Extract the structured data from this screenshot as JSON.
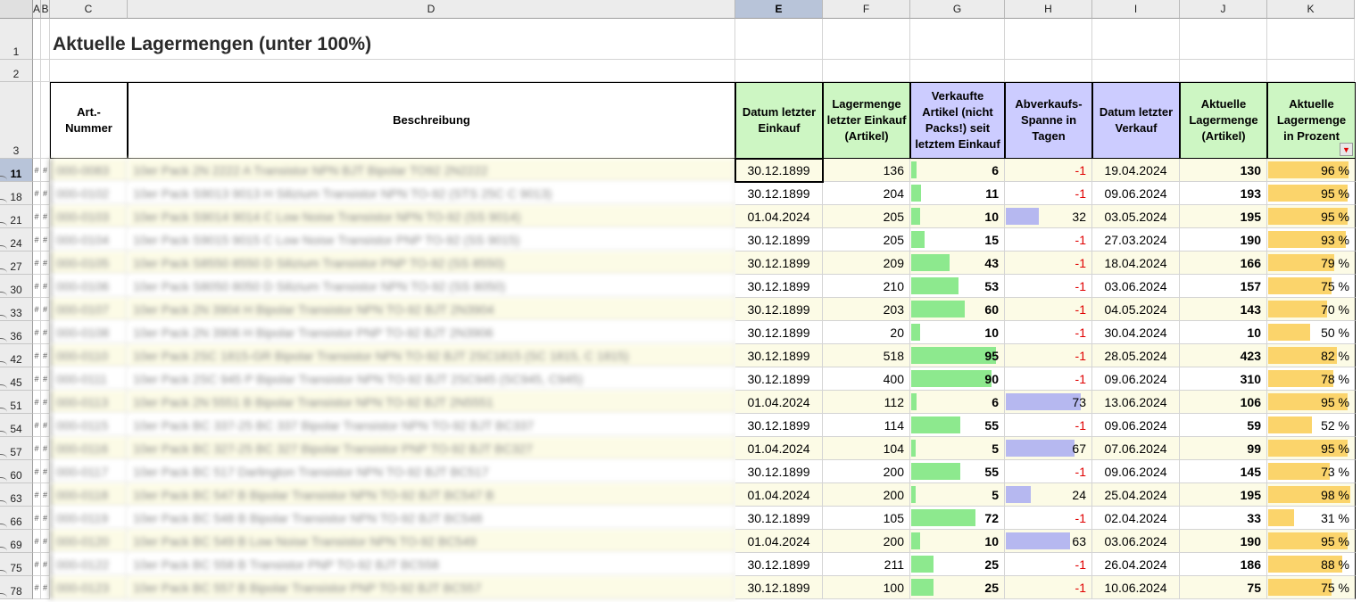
{
  "column_headers": [
    "A",
    "B",
    "C",
    "D",
    "E",
    "F",
    "G",
    "H",
    "I",
    "J",
    "K"
  ],
  "selected_column": "E",
  "row_numbers": [
    "1",
    "2",
    "3",
    "11",
    "18",
    "21",
    "24",
    "27",
    "30",
    "33",
    "36",
    "42",
    "45",
    "51",
    "54",
    "57",
    "60",
    "63",
    "66",
    "69",
    "75",
    "78"
  ],
  "selected_row": "11",
  "hash_marker": "#",
  "title": "Aktuelle Lagermengen (unter 100%)",
  "table_headers": {
    "art_nr": "Art.-Nummer",
    "beschreibung": "Beschreibung",
    "datum_einkauf": "Datum letzter Einkauf",
    "lagermenge_einkauf": "Lagermenge letzter Einkauf (Artikel)",
    "verkaufte": "Verkaufte Artikel (nicht Packs!) seit letztem Einkauf",
    "spanne": "Abverkaufs-Spanne in Tagen",
    "datum_verkauf": "Datum letzter Verkauf",
    "akt_lager": "Aktuelle Lagermenge (Artikel)",
    "akt_prozent": "Aktuelle Lagermenge in Prozent"
  },
  "filter_icon": "filter-dropdown-icon",
  "rows": [
    {
      "art": "000-0083",
      "desc": "10er Pack 2N 2222 A Transistor NPN BJT Bipolar TO92 2N2222",
      "d_ek": "30.12.1899",
      "lm_ek": 136,
      "verk": 6,
      "spanne": -1,
      "d_vk": "19.04.2024",
      "akt": 130,
      "pct": 96
    },
    {
      "art": "000-0102",
      "desc": "10er Pack S9013 9013 H Silizium Transistor NPN TO-92 (STS 25C C 9013)",
      "d_ek": "30.12.1899",
      "lm_ek": 204,
      "verk": 11,
      "spanne": -1,
      "d_vk": "09.06.2024",
      "akt": 193,
      "pct": 95
    },
    {
      "art": "000-0103",
      "desc": "10er Pack S9014 9014 C Low Noise Transistor NPN TO-92 (SS 9014)",
      "d_ek": "01.04.2024",
      "lm_ek": 205,
      "verk": 10,
      "spanne": 32,
      "d_vk": "03.05.2024",
      "akt": 195,
      "pct": 95
    },
    {
      "art": "000-0104",
      "desc": "10er Pack S9015 9015 C Low Noise Transistor PNP TO-92 (SS 9015)",
      "d_ek": "30.12.1899",
      "lm_ek": 205,
      "verk": 15,
      "spanne": -1,
      "d_vk": "27.03.2024",
      "akt": 190,
      "pct": 93
    },
    {
      "art": "000-0105",
      "desc": "10er Pack S8550 8550 D Silizium Transistor PNP TO-92 (SS 8550)",
      "d_ek": "30.12.1899",
      "lm_ek": 209,
      "verk": 43,
      "spanne": -1,
      "d_vk": "18.04.2024",
      "akt": 166,
      "pct": 79
    },
    {
      "art": "000-0106",
      "desc": "10er Pack S8050 8050 D Silizium Transistor NPN TO-92 (SS 8050)",
      "d_ek": "30.12.1899",
      "lm_ek": 210,
      "verk": 53,
      "spanne": -1,
      "d_vk": "03.06.2024",
      "akt": 157,
      "pct": 75
    },
    {
      "art": "000-0107",
      "desc": "10er Pack 2N 3904 H Bipolar Transistor NPN TO-92 BJT 2N3904",
      "d_ek": "30.12.1899",
      "lm_ek": 203,
      "verk": 60,
      "spanne": -1,
      "d_vk": "04.05.2024",
      "akt": 143,
      "pct": 70
    },
    {
      "art": "000-0108",
      "desc": "10er Pack 2N 3906 H Bipolar Transistor PNP TO-92 BJT 2N3906",
      "d_ek": "30.12.1899",
      "lm_ek": 20,
      "verk": 10,
      "spanne": -1,
      "d_vk": "30.04.2024",
      "akt": 10,
      "pct": 50
    },
    {
      "art": "000-0110",
      "desc": "10er Pack 2SC 1815-GR Bipolar Transistor NPN TO-92 BJT 2SC1815 (SC 1815, C 1815)",
      "d_ek": "30.12.1899",
      "lm_ek": 518,
      "verk": 95,
      "spanne": -1,
      "d_vk": "28.05.2024",
      "akt": 423,
      "pct": 82
    },
    {
      "art": "000-0111",
      "desc": "10er Pack 2SC 945 P Bipolar Transistor NPN TO-92 BJT 2SC945 (SC945, C945)",
      "d_ek": "30.12.1899",
      "lm_ek": 400,
      "verk": 90,
      "spanne": -1,
      "d_vk": "09.06.2024",
      "akt": 310,
      "pct": 78
    },
    {
      "art": "000-0113",
      "desc": "10er Pack 2N 5551 B Bipolar Transistor NPN TO-92 BJT 2N5551",
      "d_ek": "01.04.2024",
      "lm_ek": 112,
      "verk": 6,
      "spanne": 73,
      "d_vk": "13.06.2024",
      "akt": 106,
      "pct": 95
    },
    {
      "art": "000-0115",
      "desc": "10er Pack BC 337-25 BC 337 Bipolar Transistor NPN TO-92 BJT BC337",
      "d_ek": "30.12.1899",
      "lm_ek": 114,
      "verk": 55,
      "spanne": -1,
      "d_vk": "09.06.2024",
      "akt": 59,
      "pct": 52
    },
    {
      "art": "000-0116",
      "desc": "10er Pack BC 327-25 BC 327 Bipolar Transistor PNP TO-92 BJT BC327",
      "d_ek": "01.04.2024",
      "lm_ek": 104,
      "verk": 5,
      "spanne": 67,
      "d_vk": "07.06.2024",
      "akt": 99,
      "pct": 95
    },
    {
      "art": "000-0117",
      "desc": "10er Pack BC 517 Darlington Transistor NPN TO-92 BJT BC517",
      "d_ek": "30.12.1899",
      "lm_ek": 200,
      "verk": 55,
      "spanne": -1,
      "d_vk": "09.06.2024",
      "akt": 145,
      "pct": 73
    },
    {
      "art": "000-0118",
      "desc": "10er Pack BC 547 B Bipolar Transistor NPN TO-92 BJT BC547 B",
      "d_ek": "01.04.2024",
      "lm_ek": 200,
      "verk": 5,
      "spanne": 24,
      "d_vk": "25.04.2024",
      "akt": 195,
      "pct": 98
    },
    {
      "art": "000-0119",
      "desc": "10er Pack BC 548 B Bipolar Transistor NPN TO-92 BJT BC548",
      "d_ek": "30.12.1899",
      "lm_ek": 105,
      "verk": 72,
      "spanne": -1,
      "d_vk": "02.04.2024",
      "akt": 33,
      "pct": 31
    },
    {
      "art": "000-0120",
      "desc": "10er Pack BC 549 B Low Noise Transistor NPN TO-92 BC549",
      "d_ek": "01.04.2024",
      "lm_ek": 200,
      "verk": 10,
      "spanne": 63,
      "d_vk": "03.06.2024",
      "akt": 190,
      "pct": 95
    },
    {
      "art": "000-0122",
      "desc": "10er Pack BC 558 B Transistor PNP TO-92 BJT BC558",
      "d_ek": "30.12.1899",
      "lm_ek": 211,
      "verk": 25,
      "spanne": -1,
      "d_vk": "26.04.2024",
      "akt": 186,
      "pct": 88
    },
    {
      "art": "000-0123",
      "desc": "10er Pack BC 557 B Bipolar Transistor PNP TO-92 BJT BC557",
      "d_ek": "30.12.1899",
      "lm_ek": 100,
      "verk": 25,
      "spanne": -1,
      "d_vk": "10.06.2024",
      "akt": 75,
      "pct": 75
    }
  ],
  "colors": {
    "header_green": "#cdf6c3",
    "header_purple": "#ccccff",
    "bar_green": "#8de98e",
    "bar_blue": "#b6b8f0",
    "bar_yellow": "#fbd46b",
    "row_yellow": "#fcfbe6",
    "negative_red": "#e00000"
  }
}
